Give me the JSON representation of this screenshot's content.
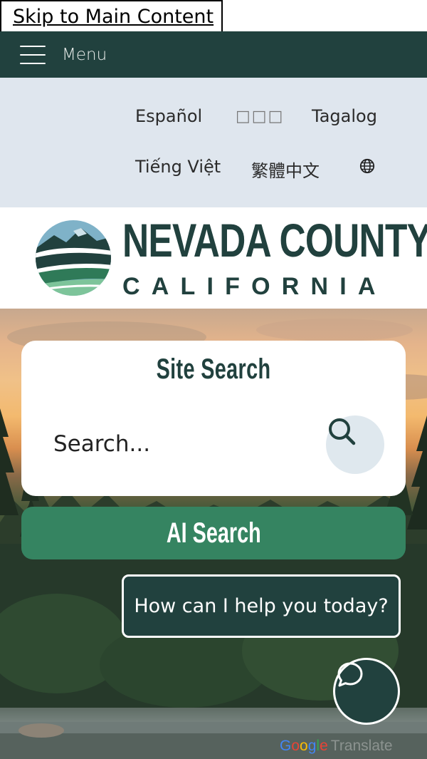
{
  "skip_link": {
    "label": "Skip to Main Content"
  },
  "nav": {
    "menu_label": "Menu",
    "menu_icon": "hamburger-icon"
  },
  "languages": {
    "items": [
      {
        "label": "Español"
      },
      {
        "label": "□□□"
      },
      {
        "label": "Tagalog"
      },
      {
        "label": "Tiếng Việt"
      },
      {
        "label": "繁體中文"
      }
    ],
    "more_icon": "globe-icon"
  },
  "logo": {
    "title": "NEVADA COUNTY",
    "subtitle": "CALIFORNIA"
  },
  "search": {
    "title": "Site Search",
    "placeholder": "Search...",
    "button_icon": "search-icon"
  },
  "ai_search": {
    "label": "AI Search"
  },
  "chat": {
    "prompt": "How can I help you today?",
    "button_icon": "chat-bubble-icon"
  },
  "google_translate": {
    "brand": [
      "G",
      "o",
      "o",
      "g",
      "l",
      "e"
    ],
    "label": "Translate"
  },
  "colors": {
    "brand_dark": "#21413e",
    "brand_green": "#358461",
    "lang_bar_bg": "#dfe6ee",
    "search_btn_bg": "#dfe8ee"
  }
}
